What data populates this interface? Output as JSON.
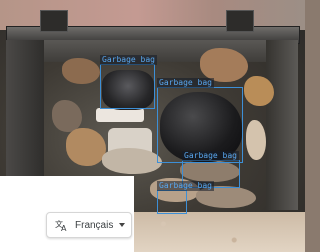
{
  "image": {
    "description_hidden": "",
    "accent_color": "#3d8fd6"
  },
  "detections": [
    {
      "label": "Garbage bag"
    },
    {
      "label": "Garbage bag"
    },
    {
      "label": "Garbage bag"
    },
    {
      "label": "Garbage bag"
    }
  ],
  "language_selector": {
    "label": "Français",
    "icon": "translate-icon",
    "caret_icon": "chevron-down-icon"
  }
}
